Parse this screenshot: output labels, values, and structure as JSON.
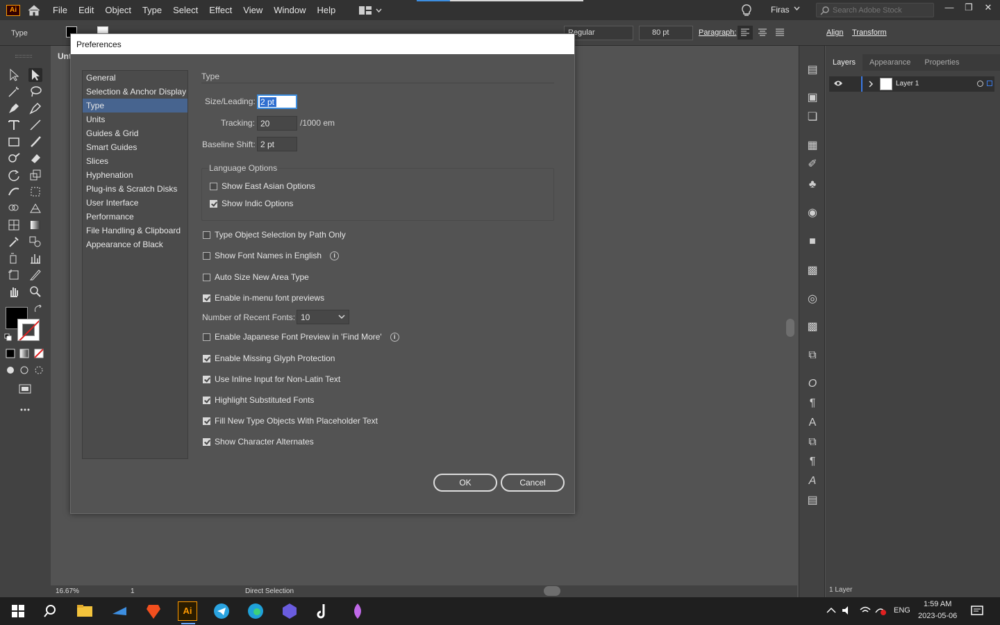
{
  "app": {
    "logo": "Ai",
    "menus": [
      "File",
      "Edit",
      "Object",
      "Type",
      "Select",
      "Effect",
      "View",
      "Window",
      "Help"
    ],
    "user": "Firas",
    "search_placeholder": "Search Adobe Stock"
  },
  "control_bar": {
    "tool_name": "Type",
    "font_style": "Regular",
    "font_size": "80 pt",
    "paragraph_label": "Paragraph:",
    "align_label": "Align",
    "transform_label": "Transform"
  },
  "document": {
    "tab_title": "Unt",
    "zoom": "16.67%",
    "artboard": "1",
    "status_tool": "Direct Selection"
  },
  "layers_panel": {
    "tabs": [
      "Layers",
      "Appearance",
      "Properties"
    ],
    "layer_name": "Layer 1",
    "layer_count": "1 Layer"
  },
  "taskbar": {
    "language": "ENG",
    "time": "1:59 AM",
    "date": "2023-05-06"
  },
  "dialog": {
    "title": "Preferences",
    "nav": [
      "General",
      "Selection & Anchor Display",
      "Type",
      "Units",
      "Guides & Grid",
      "Smart Guides",
      "Slices",
      "Hyphenation",
      "Plug-ins & Scratch Disks",
      "User Interface",
      "Performance",
      "File Handling & Clipboard",
      "Appearance of Black"
    ],
    "selected_nav": "Type",
    "pane_title": "Type",
    "size_leading_label": "Size/Leading:",
    "size_leading_value": "2 pt",
    "tracking_label": "Tracking:",
    "tracking_value": "20",
    "tracking_unit": "/1000 em",
    "baseline_label": "Baseline Shift:",
    "baseline_value": "2 pt",
    "language_options_label": "Language Options",
    "show_east_asian": {
      "label": "Show East Asian Options",
      "checked": false
    },
    "show_indic": {
      "label": "Show Indic Options",
      "checked": true
    },
    "options": [
      {
        "label": "Type Object Selection by Path Only",
        "checked": false,
        "info": false
      },
      {
        "label": "Show Font Names in English",
        "checked": false,
        "info": true
      },
      {
        "label": "Auto Size New Area Type",
        "checked": false,
        "info": false
      },
      {
        "label": "Enable in-menu font previews",
        "checked": true,
        "info": false
      }
    ],
    "recent_fonts_label": "Number of Recent Fonts:",
    "recent_fonts_value": "10",
    "options2": [
      {
        "label": "Enable Japanese Font Preview in 'Find More'",
        "checked": false,
        "info": true
      },
      {
        "label": "Enable Missing Glyph Protection",
        "checked": true,
        "info": false
      },
      {
        "label": "Use Inline Input for Non-Latin Text",
        "checked": true,
        "info": false
      },
      {
        "label": "Highlight Substituted Fonts",
        "checked": true,
        "info": false
      },
      {
        "label": "Fill New Type Objects With Placeholder Text",
        "checked": true,
        "info": false
      },
      {
        "label": "Show Character Alternates",
        "checked": true,
        "info": false
      }
    ],
    "ok_label": "OK",
    "cancel_label": "Cancel"
  }
}
